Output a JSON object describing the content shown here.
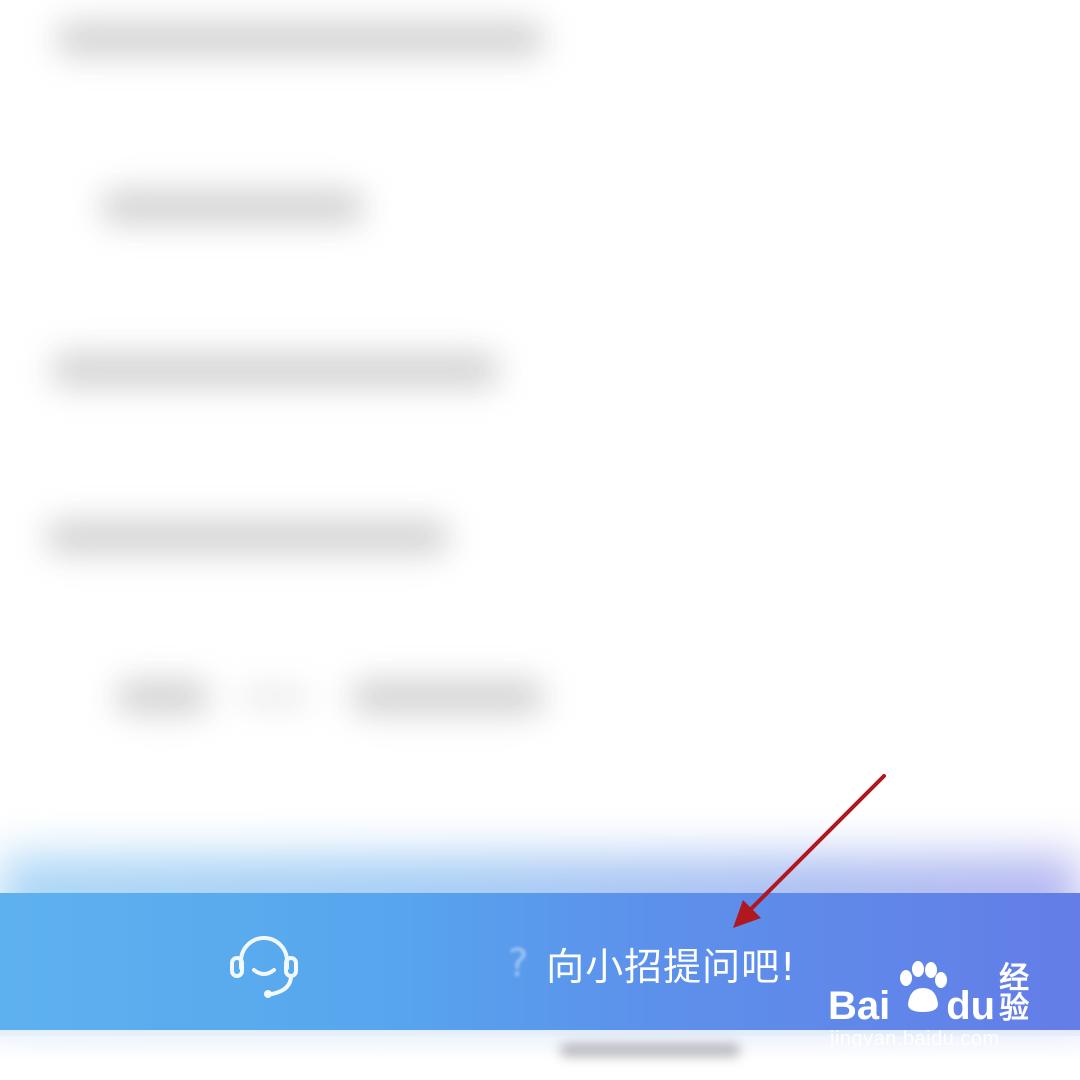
{
  "ask_bar": {
    "prompt_prefix": "?",
    "prompt_label": "向小招提问吧!"
  },
  "icons": {
    "support": "headset-icon",
    "annotation": "red-arrow-icon"
  },
  "watermark": {
    "brand_left": "Bai",
    "brand_mid": "du",
    "brand_right": "经验",
    "url": "jingyan.baidu.com"
  },
  "colors": {
    "bar_start": "#5eb1ef",
    "bar_end": "#647de7",
    "arrow": "#b0171f"
  }
}
